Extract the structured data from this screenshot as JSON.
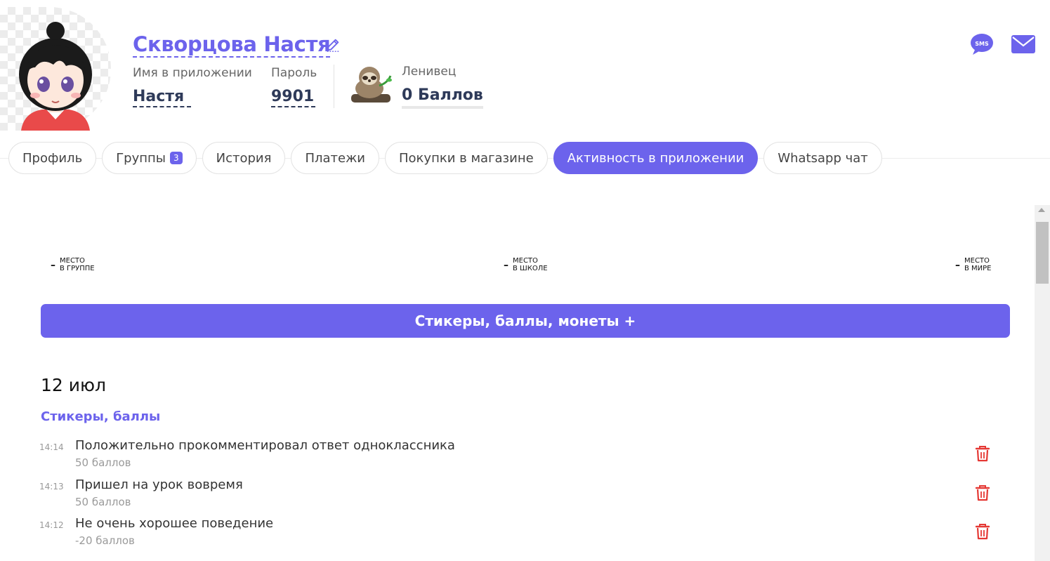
{
  "profile": {
    "full_name": "Скворцова Настя",
    "app_name_label": "Имя в приложении",
    "app_name_value": "Настя",
    "password_label": "Пароль",
    "password_value": "9901",
    "level_label": "Ленивец",
    "points_value": "0 Баллов"
  },
  "header_icons": {
    "sms": "sms-icon",
    "mail": "mail-icon"
  },
  "tabs": [
    {
      "label": "Профиль"
    },
    {
      "label": "Группы",
      "badge": "3"
    },
    {
      "label": "История"
    },
    {
      "label": "Платежи"
    },
    {
      "label": "Покупки в магазине"
    },
    {
      "label": "Активность в приложении",
      "active": true
    },
    {
      "label": "Whatsapp чат"
    }
  ],
  "ranks": [
    {
      "value": "–",
      "line1": "место",
      "line2": "в группе"
    },
    {
      "value": "–",
      "line1": "место",
      "line2": "в школе"
    },
    {
      "value": "–",
      "line1": "место",
      "line2": "в мире"
    }
  ],
  "add_button_label": "Стикеры, баллы, монеты +",
  "activity": {
    "date": "12 июл",
    "section_title": "Стикеры, баллы",
    "items": [
      {
        "time": "14:14",
        "title": "Положительно прокомментировал ответ одноклассника",
        "points": "50 баллов"
      },
      {
        "time": "14:13",
        "title": "Пришел на урок вовремя",
        "points": "50 баллов"
      },
      {
        "time": "14:12",
        "title": "Не очень хорошее поведение",
        "points": "-20 баллов"
      }
    ]
  },
  "colors": {
    "accent": "#6c63ec",
    "delete": "#e53935",
    "dark_text": "#2e3a59"
  }
}
